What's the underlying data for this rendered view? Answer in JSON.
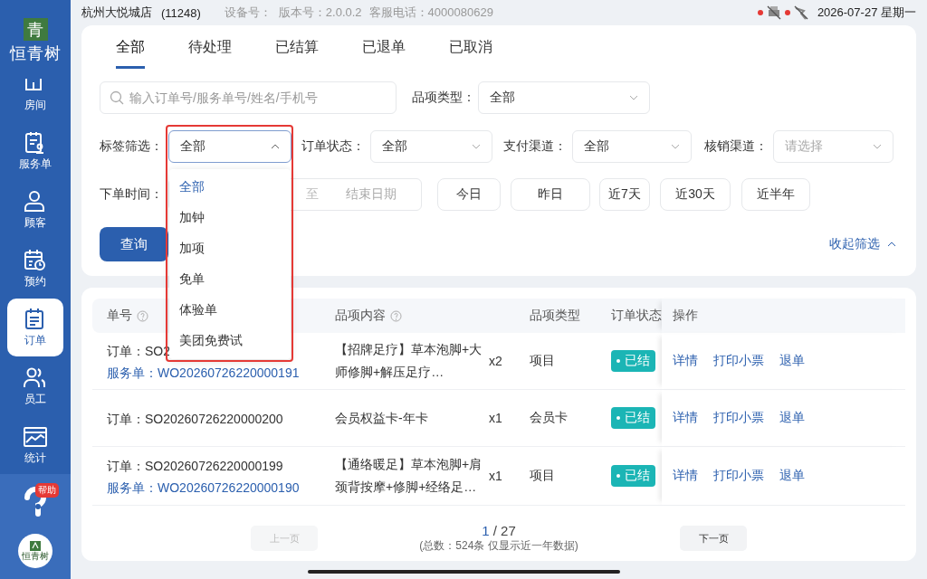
{
  "status_bar": {
    "store": "杭州大悦城店",
    "store_code": "(11248)",
    "device": "设备号：",
    "version": "版本号：2.0.0.2",
    "hotline": "客服电话：4000080629",
    "indicators": [
      {
        "kind": "printer",
        "error": true
      },
      {
        "kind": "scanner",
        "error": true
      }
    ],
    "date": "2026-07-27 星期一"
  },
  "sidebar": {
    "logo_mark": "青",
    "brand": "恒青树",
    "items": [
      {
        "label": "房间",
        "selected": false
      },
      {
        "label": "服务单",
        "selected": false
      },
      {
        "label": "顾客",
        "selected": false
      },
      {
        "label": "预约",
        "selected": false
      },
      {
        "label": "订单",
        "selected": true
      },
      {
        "label": "员工",
        "selected": false
      },
      {
        "label": "统计",
        "selected": false
      }
    ],
    "help_badge": "帮助",
    "avatar_text": "恒青树"
  },
  "tabs": [
    {
      "label": "全部",
      "selected": true
    },
    {
      "label": "待处理",
      "selected": false
    },
    {
      "label": "已结算",
      "selected": false
    },
    {
      "label": "已退单",
      "selected": false
    },
    {
      "label": "已取消",
      "selected": false
    }
  ],
  "filters": {
    "search": {
      "placeholder": "输入订单号/服务单号/姓名/手机号"
    },
    "item_type": {
      "label": "品项类型：",
      "value": "全部"
    },
    "tag_filter": {
      "label": "标签筛选：",
      "value": "全部",
      "expanded": true,
      "options": [
        {
          "label": "全部",
          "selected": true
        },
        {
          "label": "加钟",
          "selected": false
        },
        {
          "label": "加项",
          "selected": false
        },
        {
          "label": "免单",
          "selected": false
        },
        {
          "label": "体验单",
          "selected": false
        },
        {
          "label": "美团免费试",
          "selected": false
        }
      ]
    },
    "order_status": {
      "label": "订单状态：",
      "value": "全部"
    },
    "pay_channel": {
      "label": "支付渠道：",
      "value": "全部"
    },
    "verify_channel": {
      "label": "核销渠道：",
      "placeholder": "请选择"
    },
    "order_time": {
      "label": "下单时间：",
      "separator": "至",
      "end_placeholder": "结束日期"
    },
    "quick_ranges": [
      "今日",
      "昨日",
      "近7天",
      "近30天",
      "近半年"
    ],
    "query_button": "查询",
    "collapse_link": "收起筛选"
  },
  "table": {
    "columns": [
      {
        "label": "单号",
        "help": true
      },
      {
        "label": "品项内容",
        "help": true
      },
      {
        "label": "品项类型",
        "help": false
      },
      {
        "label": "订单状态",
        "help": false
      },
      {
        "label": "操作",
        "help": false
      }
    ],
    "rows": [
      {
        "order": "订单：SO2",
        "service": "服务单：WO20260726220000191",
        "items": "【招牌足疗】草本泡脚+大师修脚+解压足疗…",
        "qty": "x2",
        "type": "项目",
        "status": "已结",
        "actions": [
          "详情",
          "打印小票",
          "退单"
        ]
      },
      {
        "order": "订单：SO20260726220000200",
        "items": "会员权益卡-年卡",
        "qty": "x1",
        "type": "会员卡",
        "status": "已结",
        "actions": [
          "详情",
          "打印小票",
          "退单"
        ]
      },
      {
        "order": "订单：SO20260726220000199",
        "service": "服务单：WO20260726220000190",
        "items": "【通络暖足】草本泡脚+肩颈背按摩+修脚+经络足…",
        "qty": "x1",
        "type": "项目",
        "status": "已结",
        "actions": [
          "详情",
          "打印小票",
          "退单"
        ]
      }
    ],
    "pagination": {
      "prev": {
        "label": "上一页",
        "disabled": true
      },
      "current": "1",
      "total": "/ 27",
      "summary": "(总数：524条 仅显示近一年数据)",
      "next": {
        "label": "下一页",
        "disabled": false
      }
    }
  }
}
